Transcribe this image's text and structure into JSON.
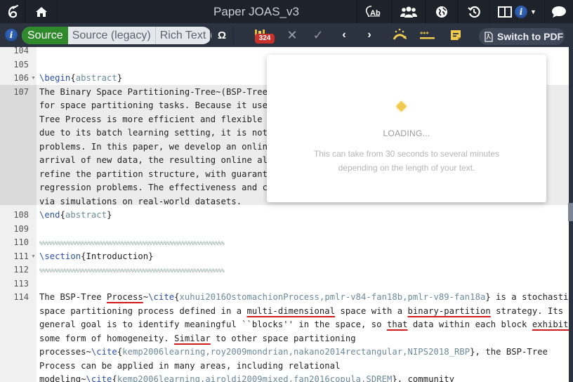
{
  "topbar": {
    "title": "Paper JOAS_v3",
    "icons": [
      "overleaf-logo-icon",
      "home-icon",
      "word-count-icon",
      "share-users-icon",
      "publish-globe-icon",
      "history-icon",
      "layout-split-icon",
      "info-icon",
      "chevron-down-icon",
      "chat-icon"
    ]
  },
  "toolbar": {
    "modes": [
      {
        "label": "Source",
        "active": true
      },
      {
        "label": "Source (legacy)",
        "active": false
      },
      {
        "label": "Rich Text",
        "active": false
      }
    ],
    "symbol_label": "Ω",
    "badge_count": "324",
    "switch_pdf_label": "Switch to PDF",
    "accent_green": "#2f8a2c",
    "badge_red": "#c9312c",
    "highlight_yellow": "#f0cb4f"
  },
  "editor": {
    "lines": [
      {
        "num": "104",
        "segments": [],
        "fold": false
      },
      {
        "num": "105",
        "segments": [],
        "fold": false
      },
      {
        "num": "106",
        "fold": true,
        "segments": [
          {
            "t": "\\begin",
            "c": "kw"
          },
          {
            "t": "{",
            "c": ""
          },
          {
            "t": "abstract",
            "c": "arg"
          },
          {
            "t": "}",
            "c": ""
          }
        ]
      },
      {
        "num": "107",
        "fold": false,
        "segments": [
          {
            "t": "The Binary Space Partitioning-Tree~(BSP-Tree)                                   p-",
            "c": ""
          }
        ]
      },
      {
        "num": "",
        "fold": false,
        "segments": [
          {
            "t": "for space partitioning tasks. Because it uses",
            "c": ""
          }
        ]
      },
      {
        "num": "",
        "fold": false,
        "segments": [
          {
            "t": "Tree Process is more efficient and flexible t                                   er,",
            "c": ""
          }
        ]
      },
      {
        "num": "",
        "fold": false,
        "segments": [
          {
            "t": "due to its batch learning setting, it is not                                    n",
            "c": ""
          }
        ]
      },
      {
        "num": "",
        "fold": false,
        "segments": [
          {
            "t": "problems. In this paper, we develop an online                                   the",
            "c": ""
          }
        ]
      },
      {
        "num": "",
        "fold": false,
        "segments": [
          {
            "t": "arrival of new data, the resulting online alg",
            "c": ""
          }
        ]
      },
      {
        "num": "",
        "fold": false,
        "segments": [
          {
            "t": "refine the partition structure, with guarante",
            "c": ""
          }
        ]
      },
      {
        "num": "",
        "fold": false,
        "segments": [
          {
            "t": "regression problems. The effectiveness and co                                   ied",
            "c": ""
          }
        ]
      },
      {
        "num": "",
        "fold": false,
        "segments": [
          {
            "t": "via simulations on real-world datasets.",
            "c": ""
          }
        ]
      },
      {
        "num": "108",
        "fold": false,
        "segments": [
          {
            "t": "\\end",
            "c": "kw"
          },
          {
            "t": "{",
            "c": ""
          },
          {
            "t": "abstract",
            "c": "arg"
          },
          {
            "t": "}",
            "c": ""
          }
        ]
      },
      {
        "num": "109",
        "fold": false,
        "segments": []
      },
      {
        "num": "110",
        "fold": false,
        "segments": [
          {
            "t": "%%%%%%%%%%%%%%%%%%%%%%%%%%%%%%%%%%%%%%%%%%%%%%%%%%%%%%%%%%%%%",
            "c": "cmt"
          }
        ]
      },
      {
        "num": "111",
        "fold": true,
        "segments": [
          {
            "t": "\\section",
            "c": "kw"
          },
          {
            "t": "{Introduction}",
            "c": ""
          }
        ]
      },
      {
        "num": "112",
        "fold": false,
        "segments": [
          {
            "t": "%%%%%%%%%%%%%%%%%%%%%%%%%%%%%%%%%%%%%%%%%%%%%%%%%%%%%%%%%%%%%",
            "c": "cmt"
          }
        ]
      },
      {
        "num": "113",
        "fold": false,
        "segments": []
      },
      {
        "num": "114",
        "fold": false,
        "segments": [
          {
            "t": "The BSP-Tree ",
            "c": ""
          },
          {
            "t": "Process",
            "c": "sp"
          },
          {
            "t": "~",
            "c": ""
          },
          {
            "t": "\\cite",
            "c": "kw"
          },
          {
            "t": "{",
            "c": ""
          },
          {
            "t": "xuhui2016OstomachionProcess,pmlr-v84-fan18b,pmlr-v89-fan18a",
            "c": "arg"
          },
          {
            "t": "} is a stochastic",
            "c": ""
          }
        ]
      },
      {
        "num": "",
        "fold": false,
        "segments": [
          {
            "t": "space partitioning process defined in a ",
            "c": ""
          },
          {
            "t": "multi-dimensional",
            "c": "sp"
          },
          {
            "t": " space with a ",
            "c": ""
          },
          {
            "t": "binary-partition",
            "c": "sp"
          },
          {
            "t": " strategy. Its",
            "c": ""
          }
        ]
      },
      {
        "num": "",
        "fold": false,
        "segments": [
          {
            "t": "general goal is to identify meaningful ``blocks'' in the space, so ",
            "c": ""
          },
          {
            "t": "that",
            "c": "sp"
          },
          {
            "t": " data within each block ",
            "c": ""
          },
          {
            "t": "exhibits",
            "c": "sp"
          }
        ]
      },
      {
        "num": "",
        "fold": false,
        "segments": [
          {
            "t": "some form of homogeneity. ",
            "c": ""
          },
          {
            "t": "Similar",
            "c": "sp"
          },
          {
            "t": " to other space partitioning",
            "c": ""
          }
        ]
      },
      {
        "num": "",
        "fold": false,
        "segments": [
          {
            "t": "processes~",
            "c": ""
          },
          {
            "t": "\\cite",
            "c": "kw"
          },
          {
            "t": "{",
            "c": ""
          },
          {
            "t": "kemp2006learning,roy2009mondrian,nakano2014rectangular,NIPS2018_RBP",
            "c": "arg"
          },
          {
            "t": "}, the BSP-Tree",
            "c": ""
          }
        ]
      },
      {
        "num": "",
        "fold": false,
        "segments": [
          {
            "t": "Process can be applied in many areas, including relational",
            "c": ""
          }
        ]
      },
      {
        "num": "",
        "fold": false,
        "segments": [
          {
            "t": "modeling~",
            "c": ""
          },
          {
            "t": "\\cite",
            "c": "kw"
          },
          {
            "t": "{",
            "c": ""
          },
          {
            "t": "kemp2006learning,airoldi2009mixed,fan2016copula,SDREM",
            "c": "arg"
          },
          {
            "t": "}, community",
            "c": ""
          }
        ]
      }
    ]
  },
  "loading": {
    "title": "LOADING...",
    "message_line1": "This can take from 30 seconds to several minutes",
    "message_line2": "depending on the length of your text."
  }
}
